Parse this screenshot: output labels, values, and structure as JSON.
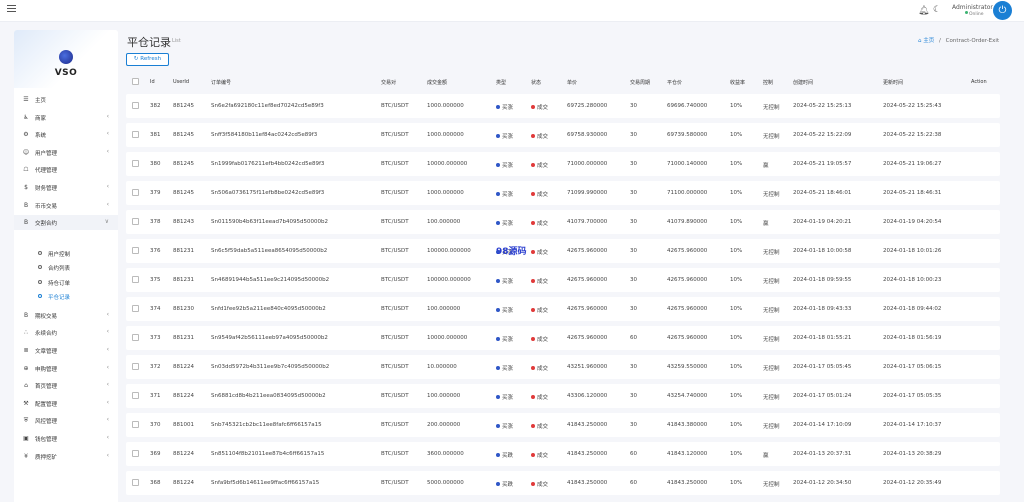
{
  "topbar": {
    "user_name": "Administrator",
    "user_status": "Online",
    "icons": [
      "menu-icon",
      "bell-icon",
      "moon-icon",
      "power-icon"
    ]
  },
  "sidebar": {
    "brand": "VSO",
    "items": [
      {
        "label": "主页",
        "icon": "dashboard-icon",
        "chevron": false
      },
      {
        "label": "商家",
        "icon": "merchant-icon",
        "chevron": true
      },
      {
        "label": "系统",
        "icon": "settings-icon",
        "chevron": true
      },
      {
        "label": "用户管理",
        "icon": "users-icon",
        "chevron": true
      },
      {
        "label": "代理管理",
        "icon": "agent-icon",
        "chevron": false
      },
      {
        "label": "财务管理",
        "icon": "dollar-icon",
        "chevron": true
      },
      {
        "label": "币币交易",
        "icon": "bitcoin-icon",
        "chevron": true
      },
      {
        "label": "交割合约",
        "icon": "bitcoin-icon",
        "chevron": true,
        "expanded": true
      }
    ],
    "sub_items": [
      {
        "label": "用户控制"
      },
      {
        "label": "合约列表"
      },
      {
        "label": "持仓订单"
      },
      {
        "label": "平仓记录",
        "active": true
      }
    ],
    "items_after": [
      {
        "label": "期权交易",
        "icon": "bitcoin-icon",
        "chevron": true
      },
      {
        "label": "永续合约",
        "icon": "perpetual-icon",
        "chevron": true
      },
      {
        "label": "文章管理",
        "icon": "article-icon",
        "chevron": true
      },
      {
        "label": "申购管理",
        "icon": "globe-icon",
        "chevron": true
      },
      {
        "label": "首页管理",
        "icon": "home-icon",
        "chevron": true
      },
      {
        "label": "配置管理",
        "icon": "wrench-icon",
        "chevron": true
      },
      {
        "label": "风控管理",
        "icon": "shield-icon",
        "chevron": true
      },
      {
        "label": "钱包管理",
        "icon": "wallet-icon",
        "chevron": true
      },
      {
        "label": "质押挖矿",
        "icon": "yen-icon",
        "chevron": true
      }
    ]
  },
  "page": {
    "title": "平仓记录",
    "subtitle": "List",
    "breadcrumb_home": "主页",
    "breadcrumb_sep": "/",
    "breadcrumb_current": "Contract-Order-Exit",
    "refresh_label": "Refresh",
    "watermark": "98源码"
  },
  "table": {
    "headers": [
      "Id",
      "UserId",
      "订单编号",
      "交易对",
      "成交金额",
      "类型",
      "状态",
      "单价",
      "交易周期",
      "平仓价",
      "收益率",
      "控制",
      "创建时间",
      "更新时间",
      "Action"
    ],
    "rows": [
      {
        "id": "382",
        "user": "881245",
        "order": "Sn6e2fa692180c11ef8ed70242cd5e89f3",
        "pair": "BTC/USDT",
        "amount": "1000.000000",
        "type": "买涨",
        "status": "成交",
        "price": "69725.280000",
        "period": "30",
        "close": "69696.740000",
        "rate": "10%",
        "control": "无控制",
        "created": "2024-05-22 15:25:13",
        "updated": "2024-05-22 15:25:43"
      },
      {
        "id": "381",
        "user": "881245",
        "order": "Snff3f584180b11ef84ac0242cd5e89f3",
        "pair": "BTC/USDT",
        "amount": "1000.000000",
        "type": "买涨",
        "status": "成交",
        "price": "69758.930000",
        "period": "30",
        "close": "69739.580000",
        "rate": "10%",
        "control": "无控制",
        "created": "2024-05-22 15:22:09",
        "updated": "2024-05-22 15:22:38"
      },
      {
        "id": "380",
        "user": "881245",
        "order": "Sn1999fab0176211efb4bb0242cd5e89f3",
        "pair": "BTC/USDT",
        "amount": "10000.000000",
        "type": "买涨",
        "status": "成交",
        "price": "71000.000000",
        "period": "30",
        "close": "71000.140000",
        "rate": "10%",
        "control": "赢",
        "created": "2024-05-21 19:05:57",
        "updated": "2024-05-21 19:06:27"
      },
      {
        "id": "379",
        "user": "881245",
        "order": "Sn506a0736175f11efb8be0242cd5e89f3",
        "pair": "BTC/USDT",
        "amount": "1000.000000",
        "type": "买涨",
        "status": "成交",
        "price": "71099.990000",
        "period": "30",
        "close": "71100.000000",
        "rate": "10%",
        "control": "无控制",
        "created": "2024-05-21 18:46:01",
        "updated": "2024-05-21 18:46:31"
      },
      {
        "id": "378",
        "user": "881243",
        "order": "Sn011590b4b63f11eead7b4095d50000b2",
        "pair": "BTC/USDT",
        "amount": "100.000000",
        "type": "买涨",
        "status": "成交",
        "price": "41079.700000",
        "period": "30",
        "close": "41079.890000",
        "rate": "10%",
        "control": "赢",
        "created": "2024-01-19 04:20:21",
        "updated": "2024-01-19 04:20:54"
      },
      {
        "id": "376",
        "user": "881231",
        "order": "Sn6c5f59dab5a511eea8654095d50000b2",
        "pair": "BTC/USDT",
        "amount": "100000.000000",
        "type": "买涨",
        "status": "成交",
        "price": "42675.960000",
        "period": "30",
        "close": "42675.960000",
        "rate": "10%",
        "control": "无控制",
        "created": "2024-01-18 10:00:58",
        "updated": "2024-01-18 10:01:26"
      },
      {
        "id": "375",
        "user": "881231",
        "order": "Sn46891944b5a511ee9c214095d50000b2",
        "pair": "BTC/USDT",
        "amount": "100000.000000",
        "type": "买涨",
        "status": "成交",
        "price": "42675.960000",
        "period": "30",
        "close": "42675.960000",
        "rate": "10%",
        "control": "无控制",
        "created": "2024-01-18 09:59:55",
        "updated": "2024-01-18 10:00:23"
      },
      {
        "id": "374",
        "user": "881230",
        "order": "Snfd1fee92b5a211ee840c4095d50000b2",
        "pair": "BTC/USDT",
        "amount": "100.000000",
        "type": "买涨",
        "status": "成交",
        "price": "42675.960000",
        "period": "30",
        "close": "42675.960000",
        "rate": "10%",
        "control": "无控制",
        "created": "2024-01-18 09:43:33",
        "updated": "2024-01-18 09:44:02"
      },
      {
        "id": "373",
        "user": "881231",
        "order": "Sn9549af42b56111eeb97a4095d50000b2",
        "pair": "BTC/USDT",
        "amount": "10000.000000",
        "type": "买涨",
        "status": "成交",
        "price": "42675.960000",
        "period": "60",
        "close": "42675.960000",
        "rate": "10%",
        "control": "无控制",
        "created": "2024-01-18 01:55:21",
        "updated": "2024-01-18 01:56:19"
      },
      {
        "id": "372",
        "user": "881224",
        "order": "Sn03dd5972b4b311ee9b7c4095d50000b2",
        "pair": "BTC/USDT",
        "amount": "10.000000",
        "type": "买涨",
        "status": "成交",
        "price": "43251.960000",
        "period": "30",
        "close": "43259.550000",
        "rate": "10%",
        "control": "无控制",
        "created": "2024-01-17 05:05:45",
        "updated": "2024-01-17 05:06:15"
      },
      {
        "id": "371",
        "user": "881224",
        "order": "Sn6881cd8b4b211eea0834095d50000b2",
        "pair": "BTC/USDT",
        "amount": "100.000000",
        "type": "买涨",
        "status": "成交",
        "price": "43306.120000",
        "period": "30",
        "close": "43254.740000",
        "rate": "10%",
        "control": "无控制",
        "created": "2024-01-17 05:01:24",
        "updated": "2024-01-17 05:05:35"
      },
      {
        "id": "370",
        "user": "881001",
        "order": "Snb745321cb2bc11ee8fafc6ff66157a15",
        "pair": "BTC/USDT",
        "amount": "200.000000",
        "type": "买涨",
        "status": "成交",
        "price": "41843.250000",
        "period": "30",
        "close": "41843.380000",
        "rate": "10%",
        "control": "无控制",
        "created": "2024-01-14 17:10:09",
        "updated": "2024-01-14 17:10:37"
      },
      {
        "id": "369",
        "user": "881224",
        "order": "Sn851104f8b21011ee87b4c6ff66157a15",
        "pair": "BTC/USDT",
        "amount": "3600.000000",
        "type": "买跌",
        "status": "成交",
        "price": "41843.250000",
        "period": "60",
        "close": "41843.120000",
        "rate": "10%",
        "control": "赢",
        "created": "2024-01-13 20:37:31",
        "updated": "2024-01-13 20:38:29"
      },
      {
        "id": "368",
        "user": "881224",
        "order": "Snfa9bf5d6b14611ee9ffac6ff66157a15",
        "pair": "BTC/USDT",
        "amount": "5000.000000",
        "type": "买跌",
        "status": "成交",
        "price": "41843.250000",
        "period": "60",
        "close": "41843.250000",
        "rate": "10%",
        "control": "无控制",
        "created": "2024-01-12 20:34:50",
        "updated": "2024-01-12 20:35:49"
      }
    ]
  },
  "colors": {
    "accent": "#1a7fd4",
    "type_dot": "#2f57c7",
    "status_dot": "#e03a3a",
    "online": "#3cb371"
  }
}
